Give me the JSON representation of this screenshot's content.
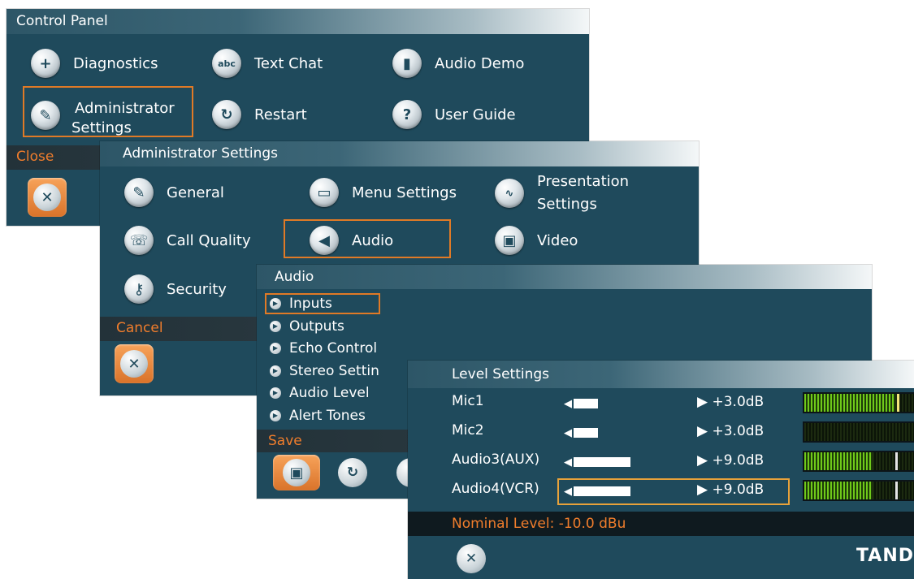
{
  "control_panel": {
    "title": "Control Panel",
    "items": [
      {
        "label": "Diagnostics",
        "icon": "plus-icon"
      },
      {
        "label": "Text Chat",
        "icon": "abc-icon",
        "glyph": "abc"
      },
      {
        "label": "Audio Demo",
        "icon": "film-strip-icon"
      },
      {
        "label": "Administrator",
        "label2": "Settings",
        "icon": "wrench-icon"
      },
      {
        "label": "Restart",
        "icon": "restart-icon"
      },
      {
        "label": "User Guide",
        "icon": "question-icon"
      }
    ],
    "footer_label": "Close"
  },
  "admin_settings": {
    "title": "Administrator Settings",
    "items": [
      {
        "label": "General",
        "icon": "wrench-icon"
      },
      {
        "label": "Menu Settings",
        "icon": "monitor-icon"
      },
      {
        "label": "Presentation",
        "label2": "Settings",
        "icon": "presentation-icon"
      },
      {
        "label": "Call Quality",
        "icon": "phone-icon"
      },
      {
        "label": "Audio",
        "icon": "speaker-icon"
      },
      {
        "label": "Video",
        "icon": "video-icon"
      },
      {
        "label": "Security",
        "icon": "key-icon"
      }
    ],
    "footer_label": "Cancel"
  },
  "audio": {
    "title": "Audio",
    "items": [
      "Inputs",
      "Outputs",
      "Echo Control",
      "Stereo Settin",
      "Audio Level",
      "Alert Tones"
    ],
    "footer_label": "Save"
  },
  "level_settings": {
    "title": "Level Settings",
    "rows": [
      {
        "name": "Mic1",
        "value": "+3.0dB",
        "level": 0.3
      },
      {
        "name": "Mic2",
        "value": "+3.0dB",
        "level": 0.3
      },
      {
        "name": "Audio3(AUX)",
        "value": "+9.0dB",
        "level": 0.8
      },
      {
        "name": "Audio4(VCR)",
        "value": "+9.0dB",
        "level": 0.8
      }
    ],
    "nominal_level": "Nominal Level: -10.0 dBu",
    "brand": "TAND"
  },
  "colors": {
    "panel": "#1f4a5c",
    "highlight": "#e07a26",
    "footer_text": "#f07d2c",
    "meter_green": "#6fc91a"
  }
}
